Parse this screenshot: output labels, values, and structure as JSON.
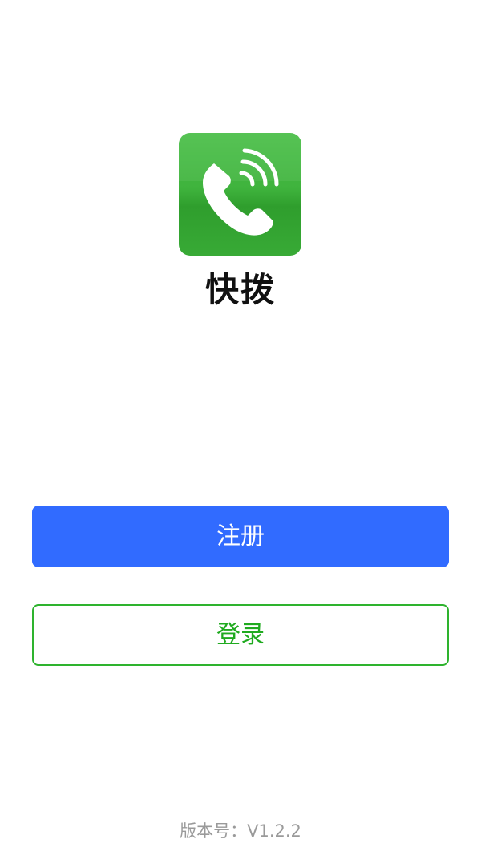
{
  "app": {
    "name": "快拨",
    "logo_icon": "phone-handset-with-signal-waves-icon",
    "brand_color": "#3fb33d"
  },
  "actions": {
    "register_label": "注册",
    "register_color": "#316bff",
    "login_label": "登录",
    "login_color": "#1faa1f"
  },
  "footer": {
    "version_text": "版本号：V1.2.2"
  }
}
